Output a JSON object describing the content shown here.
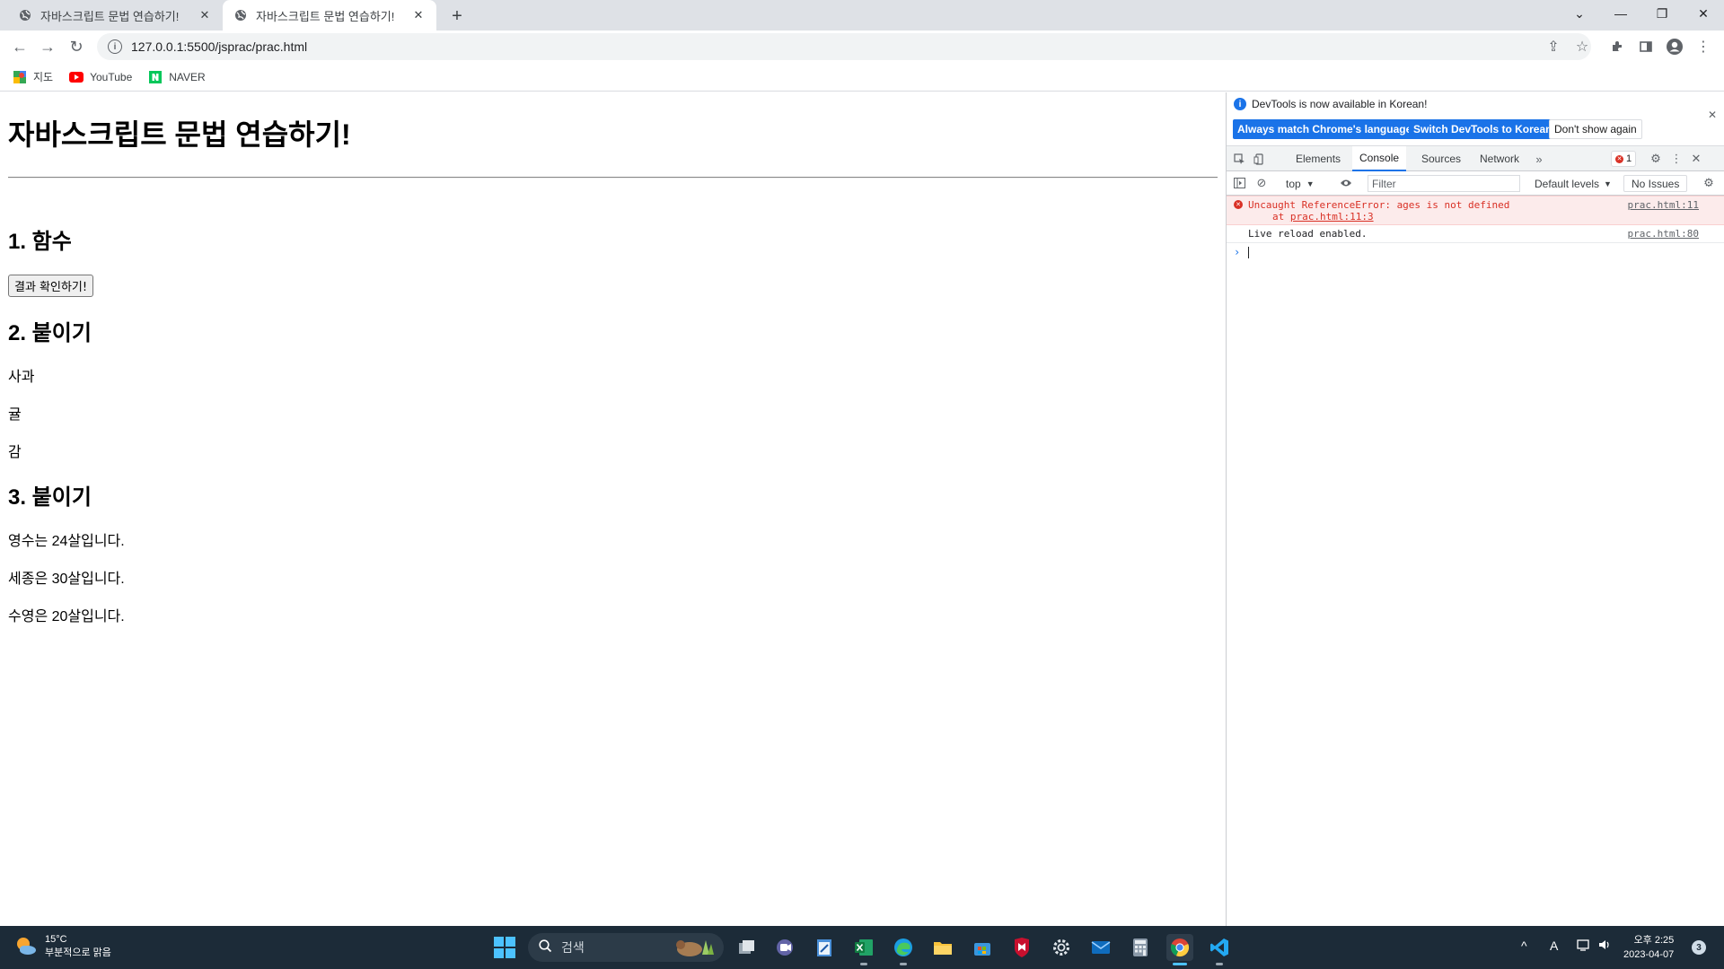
{
  "browser": {
    "tabs": [
      {
        "title": "자바스크립트 문법 연습하기!",
        "active": false
      },
      {
        "title": "자바스크립트 문법 연습하기!",
        "active": true
      }
    ],
    "url": "127.0.0.1:5500/jsprac/prac.html",
    "bookmarks": [
      {
        "label": "지도",
        "icon": "maps-icon"
      },
      {
        "label": "YouTube",
        "icon": "youtube-icon"
      },
      {
        "label": "NAVER",
        "icon": "naver-icon"
      }
    ]
  },
  "page": {
    "title": "자바스크립트 문법 연습하기!",
    "section1": {
      "heading": "1. 함수",
      "button": "결과 확인하기!"
    },
    "section2": {
      "heading": "2. 붙이기",
      "items": [
        "사과",
        "귤",
        "감"
      ]
    },
    "section3": {
      "heading": "3. 붙이기",
      "items": [
        "영수는 24살입니다.",
        "세종은 30살입니다.",
        "수영은 20살입니다."
      ]
    }
  },
  "devtools": {
    "banner": {
      "message": "DevTools is now available in Korean!",
      "btn_match": "Always match Chrome's language",
      "btn_switch": "Switch DevTools to Korean",
      "btn_dismiss": "Don't show again"
    },
    "tabs": [
      "Elements",
      "Console",
      "Sources",
      "Network"
    ],
    "active_tab": "Console",
    "error_count": "1",
    "context": "top",
    "filter_placeholder": "Filter",
    "levels": "Default levels",
    "issues": "No Issues",
    "logs": [
      {
        "type": "error",
        "message": "Uncaught ReferenceError: ages is not defined",
        "stack_prefix": "at",
        "stack_link": "prac.html:11:3",
        "source": "prac.html:11"
      },
      {
        "type": "info",
        "message": "Live reload enabled.",
        "source": "prac.html:80"
      }
    ]
  },
  "taskbar": {
    "weather_temp": "15°C",
    "weather_desc": "부분적으로 맑음",
    "search_placeholder": "검색",
    "time": "오후 2:25",
    "date": "2023-04-07",
    "notifications": "3"
  },
  "colors": {
    "accent": "#1a73e8",
    "error": "#d93025",
    "taskbar": "#1c2b38"
  }
}
